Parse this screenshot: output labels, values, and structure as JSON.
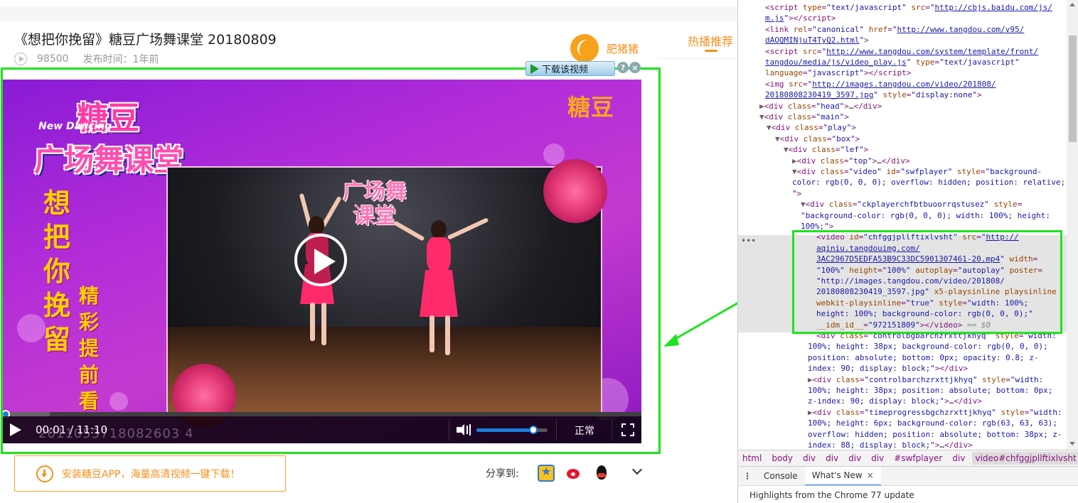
{
  "page": {
    "title": "《想把你挽留》糖豆广场舞课堂 20180809",
    "views": "98500",
    "publish_time": "发布时间：1年前",
    "author_name": "肥猪猪",
    "hot_tab": "热播推荐",
    "download_button": "下载该视频",
    "download_help": "?",
    "download_close": "×"
  },
  "video": {
    "logo_top": "糖豆",
    "logo_mid": "广场舞课堂",
    "logo_small": "New Dancing",
    "corner_brand": "糖豆",
    "vertical_title": [
      "想",
      "把",
      "你",
      "挽",
      "留"
    ],
    "vertical_sub": [
      "精",
      "彩",
      "提",
      "前",
      "看"
    ],
    "stage_logo": "广场舞\n课堂",
    "controls": {
      "time": "00:01 / 11:10",
      "watermark": "2011053718082603 4",
      "quality": "正常",
      "progress_fraction": 0.0015,
      "volume_fraction": 0.8
    }
  },
  "below": {
    "app_banner": "安装糖豆APP，海量高清视频一键下载！",
    "share_label": "分享到:"
  },
  "devtools": {
    "lines": [
      {
        "indent": 38,
        "html": "<span>&lt;script</span> <span class=\"an\">type</span>=<span class=\"av\">\"text/javascript\"</span> <span class=\"an\">src</span>=<span class=\"av\">\"</span><span class=\"lnk\">http://cbjs.baidu.com/js/</span>"
      },
      {
        "indent": 38,
        "html": "<span class=\"lnk\">m.js</span><span class=\"av\">\"</span>&gt;&lt;/script&gt;"
      },
      {
        "indent": 38,
        "html": "&lt;link <span class=\"an\">rel</span>=<span class=\"av\">\"canonical\"</span> <span class=\"an\">href</span>=<span class=\"av\">\"</span><span class=\"lnk\">http://www.tangdou.com/v95/</span>"
      },
      {
        "indent": 38,
        "html": "<span class=\"lnk\">dAOQMINjuT4TyQ2.html</span><span class=\"av\">\"</span>&gt;"
      },
      {
        "indent": 38,
        "html": "&lt;script <span class=\"an\">src</span>=<span class=\"av\">\"</span><span class=\"lnk\">http://www.tangdou.com/system/template/front/</span>"
      },
      {
        "indent": 38,
        "html": "<span class=\"lnk\">tangdou/media/js/video_play.js</span><span class=\"av\">\"</span> <span class=\"an\">type</span>=<span class=\"av\">\"text/javascript\"</span>"
      },
      {
        "indent": 38,
        "html": "<span class=\"an\">language</span>=<span class=\"av\">\"javascript\"</span>&gt;&lt;/script&gt;"
      },
      {
        "indent": 38,
        "html": "&lt;img <span class=\"an\">src</span>=<span class=\"av\">\"</span><span class=\"lnk\">http://images.tangdou.com/video/201808/</span>"
      },
      {
        "indent": 38,
        "html": "<span class=\"lnk\">20180808230419_3597.jpg</span><span class=\"av\">\"</span> <span class=\"an\">style</span>=<span class=\"av\">\"display:none\"</span>&gt;"
      },
      {
        "indent": 30,
        "html": "<span class=\"dt-tri\">▶</span>&lt;div <span class=\"an\">class</span>=<span class=\"av\">\"head\"</span>&gt;<span class=\"txt\">…</span>&lt;/div&gt;"
      },
      {
        "indent": 30,
        "html": "<span class=\"dt-tri\">▼</span>&lt;div <span class=\"an\">class</span>=<span class=\"av\">\"main\"</span>&gt;"
      },
      {
        "indent": 40,
        "html": "<span class=\"dt-tri\">▼</span>&lt;div <span class=\"an\">class</span>=<span class=\"av\">\"play\"</span>&gt;"
      },
      {
        "indent": 52,
        "html": "<span class=\"dt-tri\">▼</span>&lt;div <span class=\"an\">class</span>=<span class=\"av\">\"box\"</span>&gt;"
      },
      {
        "indent": 64,
        "html": "<span class=\"dt-tri\">▼</span>&lt;div <span class=\"an\">class</span>=<span class=\"av\">\"lef\"</span>&gt;"
      },
      {
        "indent": 76,
        "html": "<span class=\"dt-tri\">▶</span>&lt;div <span class=\"an\">class</span>=<span class=\"av\">\"top\"</span>&gt;<span class=\"txt\">…</span>&lt;/div&gt;"
      },
      {
        "indent": 76,
        "html": "<span class=\"dt-tri\">▼</span>&lt;div <span class=\"an\">class</span>=<span class=\"av\">\"video\"</span> <span class=\"an\">id</span>=<span class=\"av\">\"swfplayer\"</span> <span class=\"an\">style</span>=<span class=\"av\">\"background-</span>"
      },
      {
        "indent": 76,
        "html": "<span class=\"av\">color: rgb(0, 0, 0); overflow: hidden; position: relative;</span>"
      },
      {
        "indent": 76,
        "html": "<span class=\"av\">\"</span>&gt;"
      },
      {
        "indent": 88,
        "html": "<span class=\"dt-tri\">▼</span>&lt;div <span class=\"an\">class</span>=<span class=\"av\">\"ckplayerchfbtbuoorrqstusez\"</span> <span class=\"an\">style</span>="
      },
      {
        "indent": 88,
        "html": "<span class=\"av\">\"background-color: rgb(0, 0, 0); width: 100%; height:</span>"
      },
      {
        "indent": 88,
        "html": "<span class=\"av\">100%;\"</span>&gt;"
      },
      {
        "indent": 110,
        "html": "&lt;video <span class=\"an\">id</span>=<span class=\"av\">\"chfggjpllftixlvsht\"</span> <span class=\"an\">src</span>=<span class=\"av\">\"</span><span class=\"lnk\">http://</span>"
      },
      {
        "indent": 110,
        "html": "<span class=\"lnk\">aqiniu.tangdouimg.com/</span>"
      },
      {
        "indent": 110,
        "html": "<span class=\"lnk\">3AC2967D5EDFA53B9C33DC5901307461-20.mp4</span><span class=\"av\">\"</span> <span class=\"an\">width</span>="
      },
      {
        "indent": 110,
        "html": "<span class=\"av\">\"100%\"</span> <span class=\"an\">height</span>=<span class=\"av\">\"100%\"</span> <span class=\"an\">autoplay</span>=<span class=\"av\">\"autoplay\"</span> <span class=\"an\">poster</span>="
      },
      {
        "indent": 110,
        "html": "<span class=\"av\">\"http://images.tangdou.com/video/201808/</span>"
      },
      {
        "indent": 110,
        "html": "<span class=\"av\">20180808230419_3597.jpg\"</span> <span class=\"an\">x5-playsinline playsinline</span>"
      },
      {
        "indent": 110,
        "html": "<span class=\"an\">webkit-playsinline</span>=<span class=\"av\">\"true\"</span> <span class=\"an\">style</span>=<span class=\"av\">\"width: 100%;</span>"
      },
      {
        "indent": 110,
        "html": "<span class=\"av\">height: 100%; background-color: rgb(0, 0, 0);\"</span>"
      },
      {
        "indent": 110,
        "html": "<span class=\"an\">__idm_id__</span>=<span class=\"av\">\"972151809\"</span>&gt;&lt;/video&gt; <span class=\"cm\">== $0</span>"
      },
      {
        "indent": 110,
        "html": "&lt;div <span class=\"an\">class</span>=<span class=\"av\">\"controlbgbarchzrxttjkhyq\"</span> <span class=\"an\">style</span>=<span class=\"av\">\"width:</span>"
      },
      {
        "indent": 98,
        "html": "<span class=\"av\">100%; height: 38px; background-color: rgb(0, 0, 0);</span>"
      },
      {
        "indent": 98,
        "html": "<span class=\"av\">position: absolute; bottom: 0px; opacity: 0.8; z-</span>"
      },
      {
        "indent": 98,
        "html": "<span class=\"av\">index: 90; display: block;\"</span>&gt;&lt;/div&gt;"
      },
      {
        "indent": 98,
        "html": "<span class=\"dt-tri\">▶</span>&lt;div <span class=\"an\">class</span>=<span class=\"av\">\"controlbarchzrxttjkhyq\"</span> <span class=\"an\">style</span>=<span class=\"av\">\"width:</span>"
      },
      {
        "indent": 98,
        "html": "<span class=\"av\">100%; height: 38px; position: absolute; bottom: 0px;</span>"
      },
      {
        "indent": 98,
        "html": "<span class=\"av\">z-index: 90; display: block;\"</span>&gt;<span class=\"txt\">…</span>&lt;/div&gt;"
      },
      {
        "indent": 98,
        "html": "<span class=\"dt-tri\">▶</span>&lt;div <span class=\"an\">class</span>=<span class=\"av\">\"timeprogressbgchzrxttjkhyq\"</span> <span class=\"an\">style</span>=<span class=\"av\">\"width:</span>"
      },
      {
        "indent": 98,
        "html": "<span class=\"av\">100%; height: 6px; background-color: rgb(63, 63, 63);</span>"
      },
      {
        "indent": 98,
        "html": "<span class=\"av\">overflow: hidden; position: absolute; bottom: 38px; z-</span>"
      },
      {
        "indent": 98,
        "html": "<span class=\"av\">index: 88; display: block;\"</span>&gt;<span class=\"txt\">…</span>&lt;/div&gt;"
      }
    ],
    "breadcrumbs": [
      "html",
      "body",
      "div",
      "div",
      "div",
      "div",
      "#swfplayer",
      "div",
      "video#chfggjpllftixlvsht"
    ],
    "drawer_menu": "⋮",
    "drawer_tabs": [
      "Console",
      "What's New"
    ],
    "drawer_close": "×",
    "drawer_body": "Highlights from the Chrome 77 update"
  }
}
